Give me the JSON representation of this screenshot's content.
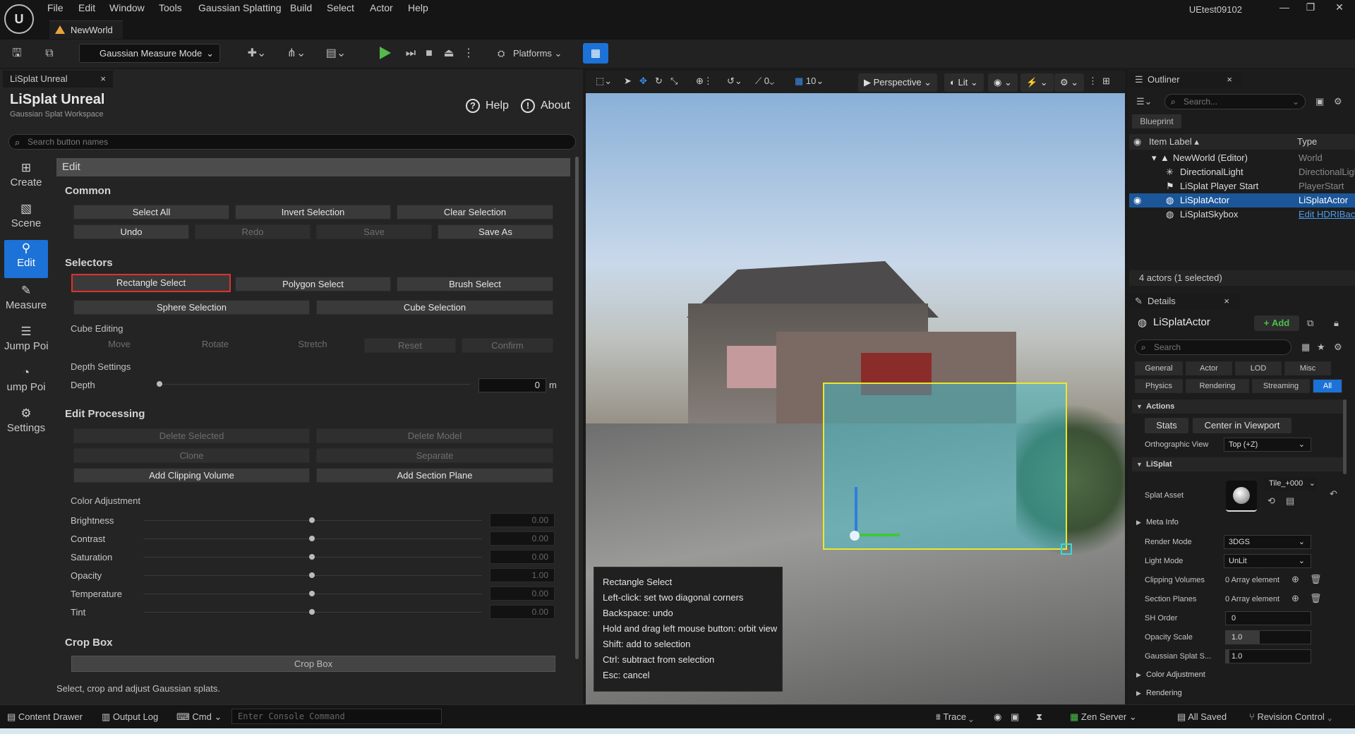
{
  "window": {
    "menus": [
      "File",
      "Edit",
      "Window",
      "Tools",
      "Gaussian Splatting",
      "Build",
      "Select",
      "Actor",
      "Help"
    ],
    "project_name": "UEtest09102",
    "map_tab": "NewWorld"
  },
  "toolbar": {
    "mode_label": "Gaussian Measure Mode",
    "platforms_label": "Platforms"
  },
  "left_panel": {
    "tab_label": "LiSplat Unreal",
    "title": "LiSplat Unreal",
    "subtitle": "Gaussian Splat Workspace",
    "help_label": "Help",
    "about_label": "About",
    "search_placeholder": "Search button names",
    "nav": [
      "Create",
      "Scene",
      "Edit",
      "Measure",
      "Jump Point",
      "Settings"
    ],
    "section_header": "Edit",
    "common": {
      "title": "Common",
      "select_all": "Select All",
      "invert_selection": "Invert Selection",
      "clear_selection": "Clear Selection",
      "undo": "Undo",
      "redo": "Redo",
      "save": "Save",
      "save_as": "Save As"
    },
    "selectors": {
      "title": "Selectors",
      "rectangle": "Rectangle Select",
      "polygon": "Polygon Select",
      "brush": "Brush Select",
      "sphere": "Sphere Selection",
      "cube": "Cube Selection"
    },
    "cube_editing": {
      "title": "Cube Editing",
      "move": "Move",
      "rotate": "Rotate",
      "stretch": "Stretch",
      "reset": "Reset",
      "confirm": "Confirm"
    },
    "depth": {
      "title": "Depth Settings",
      "label": "Depth",
      "value": "0",
      "unit": "m"
    },
    "edit_processing": {
      "title": "Edit Processing",
      "delete_selected": "Delete Selected",
      "delete_model": "Delete Model",
      "clone": "Clone",
      "separate": "Separate",
      "add_clipping": "Add Clipping Volume",
      "add_section": "Add Section Plane"
    },
    "color_adjustment": {
      "title": "Color Adjustment",
      "rows": [
        {
          "label": "Brightness",
          "value": "0.00"
        },
        {
          "label": "Contrast",
          "value": "0.00"
        },
        {
          "label": "Saturation",
          "value": "0.00"
        },
        {
          "label": "Opacity",
          "value": "1.00"
        },
        {
          "label": "Temperature",
          "value": "0.00"
        },
        {
          "label": "Tint",
          "value": "0.00"
        }
      ]
    },
    "crop_box": {
      "title": "Crop Box",
      "button": "Crop Box"
    },
    "footer": "Select, crop and adjust Gaussian splats."
  },
  "viewport": {
    "perspective": "Perspective",
    "lit": "Lit",
    "angle": "0",
    "grid": "10",
    "tooltip": [
      "Rectangle Select",
      "Left-click: set two diagonal corners",
      "Backspace: undo",
      "Hold and drag left mouse button: orbit view",
      "Shift: add to selection",
      "Ctrl: subtract from selection",
      "Esc: cancel"
    ]
  },
  "outliner": {
    "tab": "Outliner",
    "search_placeholder": "Search...",
    "blueprint": "Blueprint",
    "col_label": "Item Label",
    "col_type": "Type",
    "rows": [
      {
        "label": "NewWorld (Editor)",
        "type": "World"
      },
      {
        "label": "DirectionalLight",
        "type": "DirectionalLight"
      },
      {
        "label": "LiSplat Player Start",
        "type": "PlayerStart"
      },
      {
        "label": "LiSplatActor",
        "type": "LiSplatActor"
      },
      {
        "label": "LiSplatSkybox",
        "type": "Edit HDRIBackdrop"
      }
    ],
    "count": "4 actors (1 selected)"
  },
  "details": {
    "tab": "Details",
    "actor": "LiSplatActor",
    "add_label": "Add",
    "search_placeholder": "Search",
    "filters_row1": [
      "General",
      "Actor",
      "LOD",
      "Misc"
    ],
    "filters_row2": [
      "Physics",
      "Rendering",
      "Streaming",
      "All"
    ],
    "actions_title": "Actions",
    "stats_btn": "Stats",
    "center_btn": "Center in Viewport",
    "ortho_label": "Orthographic View",
    "ortho_value": "Top (+Z)",
    "lisplat_title": "LiSplat",
    "splat_asset_label": "Splat Asset",
    "tile_value": "Tile_+000",
    "meta_info": "Meta Info",
    "render_mode_label": "Render Mode",
    "render_mode_value": "3DGS",
    "light_mode_label": "Light Mode",
    "light_mode_value": "UnLit",
    "clipping_label": "Clipping Volumes",
    "clipping_value": "0 Array element",
    "section_label": "Section Planes",
    "section_value": "0 Array element",
    "sh_label": "SH Order",
    "sh_value": "0",
    "opacity_label": "Opacity Scale",
    "opacity_value": "1.0",
    "gsplat_label": "Gaussian Splat S...",
    "gsplat_value": "1.0",
    "color_adj": "Color Adjustment",
    "rendering": "Rendering"
  },
  "statusbar": {
    "content_drawer": "Content Drawer",
    "output_log": "Output Log",
    "cmd": "Cmd",
    "console_placeholder": "Enter Console Command",
    "trace": "Trace",
    "zen": "Zen Server",
    "saved": "All Saved",
    "revision": "Revision Control"
  },
  "colors": {
    "accent": "#1c72d6",
    "highlight_border": "#e03030",
    "selection_rect": "#e8e830"
  }
}
